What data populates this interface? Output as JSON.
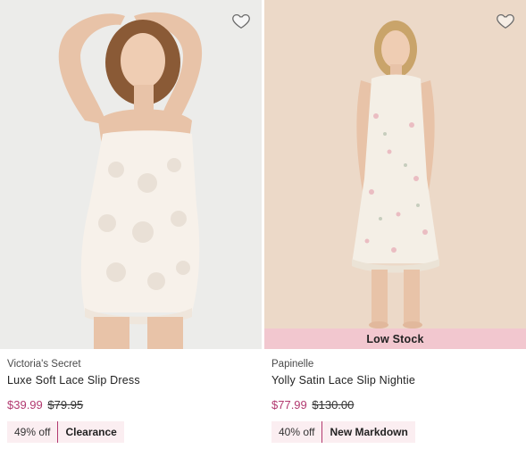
{
  "products": [
    {
      "brand": "Victoria's Secret",
      "name": "Luxe Soft Lace Slip Dress",
      "sale_price": "$39.99",
      "original_price": "$79.95",
      "discount": "49% off",
      "tag": "Clearance",
      "stock_label": "",
      "wishlist_icon": "heart-outline-icon"
    },
    {
      "brand": "Papinelle",
      "name": "Yolly Satin Lace Slip Nightie",
      "sale_price": "$77.99",
      "original_price": "$130.00",
      "discount": "40% off",
      "tag": "New Markdown",
      "stock_label": "Low Stock",
      "wishlist_icon": "heart-outline-icon"
    }
  ],
  "colors": {
    "sale_price": "#b23a70",
    "badge_background": "#fbeef1",
    "stock_band": "#f2c7cf"
  }
}
